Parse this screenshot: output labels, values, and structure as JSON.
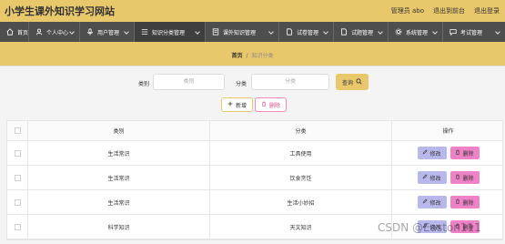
{
  "app": {
    "title": "小学生课外知识学习网站",
    "user_label": "管理员 abo",
    "links": [
      "退出到前台",
      "退出登录"
    ]
  },
  "nav": [
    {
      "label": "首页",
      "icon": "home-icon",
      "active": false
    },
    {
      "label": "个人中心",
      "icon": "user-icon",
      "active": false
    },
    {
      "label": "用户管理",
      "icon": "mic-icon",
      "active": false
    },
    {
      "label": "知识分类管理",
      "icon": "list-icon",
      "active": true
    },
    {
      "label": "课外知识管理",
      "icon": "book-icon",
      "active": false
    },
    {
      "label": "试卷管理",
      "icon": "doc-icon",
      "active": false
    },
    {
      "label": "试题管理",
      "icon": "doc-icon",
      "active": false
    },
    {
      "label": "系统管理",
      "icon": "gear-icon",
      "active": false
    },
    {
      "label": "考试管理",
      "icon": "chat-icon",
      "active": false
    }
  ],
  "breadcrumb": {
    "home": "首页",
    "current": "知识分类"
  },
  "search": {
    "category_label": "类别",
    "category_placeholder": "类别",
    "type_label": "分类",
    "type_placeholder": "分类",
    "query_label": "查询"
  },
  "actions": {
    "add_label": "新增",
    "delete_label": "删除"
  },
  "table": {
    "headers": [
      "类别",
      "分类",
      "操作"
    ],
    "rows": [
      {
        "category": "生活常识",
        "type": "工具使用"
      },
      {
        "category": "生活常识",
        "type": "饮食烹饪"
      },
      {
        "category": "生活常识",
        "type": "生活小妙招"
      },
      {
        "category": "科学知识",
        "type": "天文知识"
      }
    ],
    "edit_label": "修改",
    "delete_label": "删除"
  },
  "watermark": "CSDN @Easton111"
}
